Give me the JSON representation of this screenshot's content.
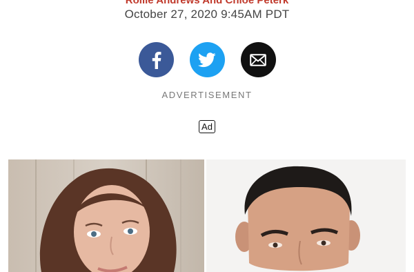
{
  "article": {
    "byline": "Rollie Andrews And Chloe Peterk",
    "dateline": "October 27, 2020 9:45AM PDT"
  },
  "share": {
    "facebook": {
      "icon": "facebook-icon",
      "color": "#3b5998"
    },
    "twitter": {
      "icon": "twitter-icon",
      "color": "#1da1f2"
    },
    "email": {
      "icon": "envelope-icon",
      "color": "#111111"
    }
  },
  "ad": {
    "label": "ADVERTISEMENT",
    "badge": "Ad"
  },
  "photos": [
    {
      "name": "portrait-woman"
    },
    {
      "name": "portrait-man"
    }
  ],
  "colors": {
    "byline": "#c0392b",
    "date": "#444444",
    "ad_label": "#777777"
  }
}
